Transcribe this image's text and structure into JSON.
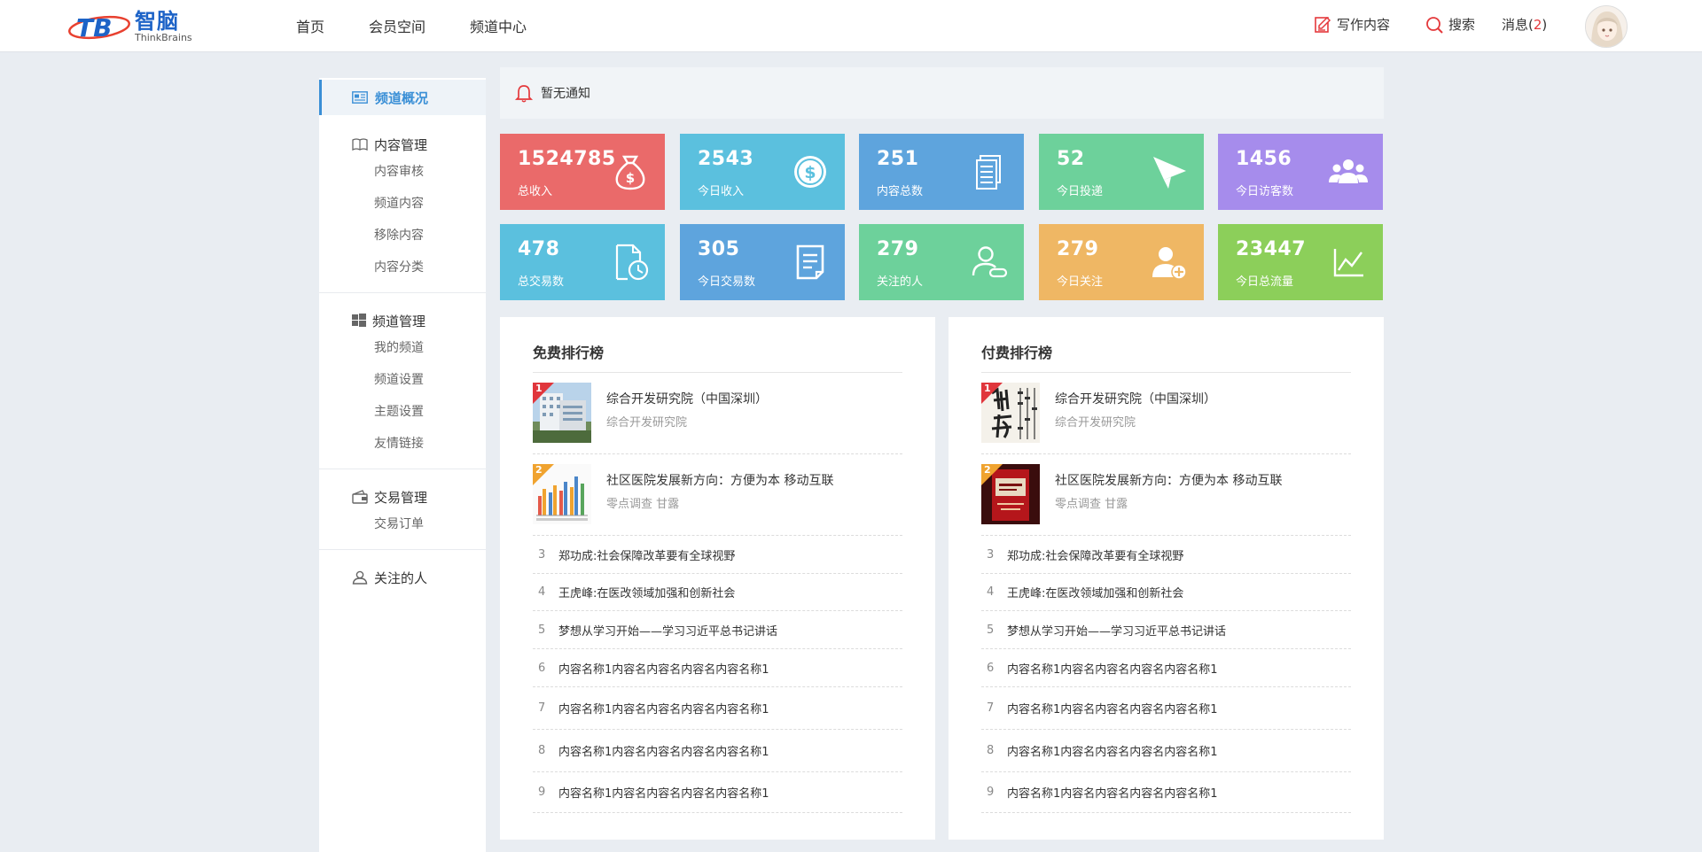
{
  "header": {
    "logo_letters": "TB",
    "logo_cn": "智脑",
    "logo_en": "ThinkBrains",
    "nav": [
      "首页",
      "会员空间",
      "频道中心"
    ],
    "write_label": "写作内容",
    "search_label": "搜索",
    "messages_label": "消息(",
    "messages_count": "2",
    "messages_close": ")"
  },
  "sidebar": {
    "active": "频道概况",
    "groups": [
      {
        "title": "内容管理",
        "icon": "book-icon",
        "items": [
          "内容审核",
          "频道内容",
          "移除内容",
          "内容分类"
        ]
      },
      {
        "title": "频道管理",
        "icon": "windows-icon",
        "items": [
          "我的频道",
          "频道设置",
          "主题设置",
          "友情链接"
        ]
      },
      {
        "title": "交易管理",
        "icon": "wallet-icon",
        "items": [
          "交易订单"
        ]
      },
      {
        "title": "关注的人",
        "icon": "user-icon",
        "items": []
      }
    ]
  },
  "notice": {
    "text": "暂无通知",
    "icon": "bell-icon"
  },
  "stats": [
    {
      "value": "1524785",
      "label": "总收入",
      "color": "#ea6a6a",
      "icon": "money-bag-icon"
    },
    {
      "value": "2543",
      "label": "今日收入",
      "color": "#5bc0de",
      "icon": "dollar-coin-icon"
    },
    {
      "value": "251",
      "label": "内容总数",
      "color": "#5ea4dd",
      "icon": "documents-icon"
    },
    {
      "value": "52",
      "label": "今日投递",
      "color": "#6dd19b",
      "icon": "send-icon"
    },
    {
      "value": "1456",
      "label": "今日访客数",
      "color": "#a68cec",
      "icon": "users-icon"
    },
    {
      "value": "478",
      "label": "总交易数",
      "color": "#5bc0de",
      "icon": "file-clock-icon"
    },
    {
      "value": "305",
      "label": "今日交易数",
      "color": "#5ea4dd",
      "icon": "receipt-icon"
    },
    {
      "value": "279",
      "label": "关注的人",
      "color": "#6dd19b",
      "icon": "user-follow-icon"
    },
    {
      "value": "279",
      "label": "今日关注",
      "color": "#efb764",
      "icon": "user-add-icon"
    },
    {
      "value": "23447",
      "label": "今日总流量",
      "color": "#8ccf5a",
      "icon": "line-chart-icon"
    }
  ],
  "free_rank": {
    "title": "免费排行榜",
    "featured": [
      {
        "rank": "1",
        "title": "综合开发研究院（中国深圳）",
        "sub": "综合开发研究院"
      },
      {
        "rank": "2",
        "title": "社区医院发展新方向：方便为本 移动互联",
        "sub": "零点调查 甘露"
      }
    ],
    "list": [
      {
        "n": "3",
        "t": "郑功成:社会保障改革要有全球视野"
      },
      {
        "n": "4",
        "t": "王虎峰:在医改领域加强和创新社会"
      },
      {
        "n": "5",
        "t": "梦想从学习开始——学习习近平总书记讲话"
      },
      {
        "n": "6",
        "t": "内容名称1内容名内容名内容名内容名称1"
      },
      {
        "n": "7",
        "t": "内容名称1内容名内容名内容名内容名称1"
      },
      {
        "n": "8",
        "t": "内容名称1内容名内容名内容名内容名称1"
      },
      {
        "n": "9",
        "t": "内容名称1内容名内容名内容名内容名称1"
      }
    ]
  },
  "paid_rank": {
    "title": "付费排行榜",
    "featured": [
      {
        "rank": "1",
        "title": "综合开发研究院（中国深圳）",
        "sub": "综合开发研究院"
      },
      {
        "rank": "2",
        "title": "社区医院发展新方向：方便为本 移动互联",
        "sub": "零点调查 甘露"
      }
    ],
    "list": [
      {
        "n": "3",
        "t": "郑功成:社会保障改革要有全球视野"
      },
      {
        "n": "4",
        "t": "王虎峰:在医改领域加强和创新社会"
      },
      {
        "n": "5",
        "t": "梦想从学习开始——学习习近平总书记讲话"
      },
      {
        "n": "6",
        "t": "内容名称1内容名内容名内容名内容名称1"
      },
      {
        "n": "7",
        "t": "内容名称1内容名内容名内容名内容名称1"
      },
      {
        "n": "8",
        "t": "内容名称1内容名内容名内容名内容名称1"
      },
      {
        "n": "9",
        "t": "内容名称1内容名内容名内容名内容名称1"
      }
    ]
  }
}
